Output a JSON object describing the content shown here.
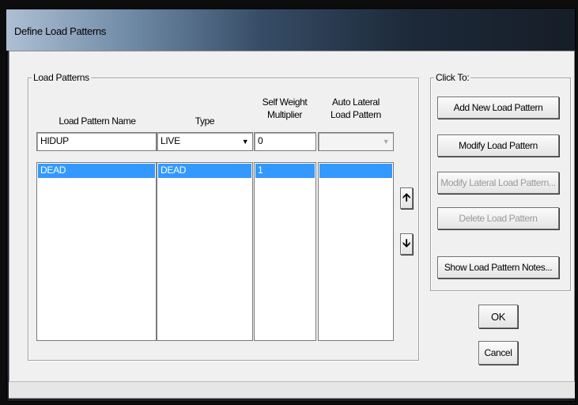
{
  "window": {
    "title": "Define Load Patterns"
  },
  "load_patterns": {
    "group_label": "Load Patterns",
    "columns": {
      "name": "Load Pattern Name",
      "type": "Type",
      "self_weight_line1": "Self Weight",
      "self_weight_line2": "Multiplier",
      "auto_lateral_line1": "Auto Lateral",
      "auto_lateral_line2": "Load Pattern"
    },
    "inputs": {
      "name": "HIDUP",
      "type": "LIVE",
      "self_weight": "0",
      "auto_lateral": ""
    },
    "rows": [
      {
        "name": "DEAD",
        "type": "DEAD",
        "self_weight": "1",
        "auto_lateral": "",
        "selected": true
      }
    ]
  },
  "click_to": {
    "group_label": "Click To:",
    "buttons": {
      "add": "Add New Load Pattern",
      "modify": "Modify Load Pattern",
      "modify_lateral": "Modify Lateral Load Pattern...",
      "delete": "Delete Load Pattern",
      "notes": "Show Load Pattern Notes..."
    }
  },
  "footer": {
    "ok": "OK",
    "cancel": "Cancel"
  },
  "colors": {
    "selection": "#3399ff",
    "dialog_bg": "#f0f0f0"
  }
}
